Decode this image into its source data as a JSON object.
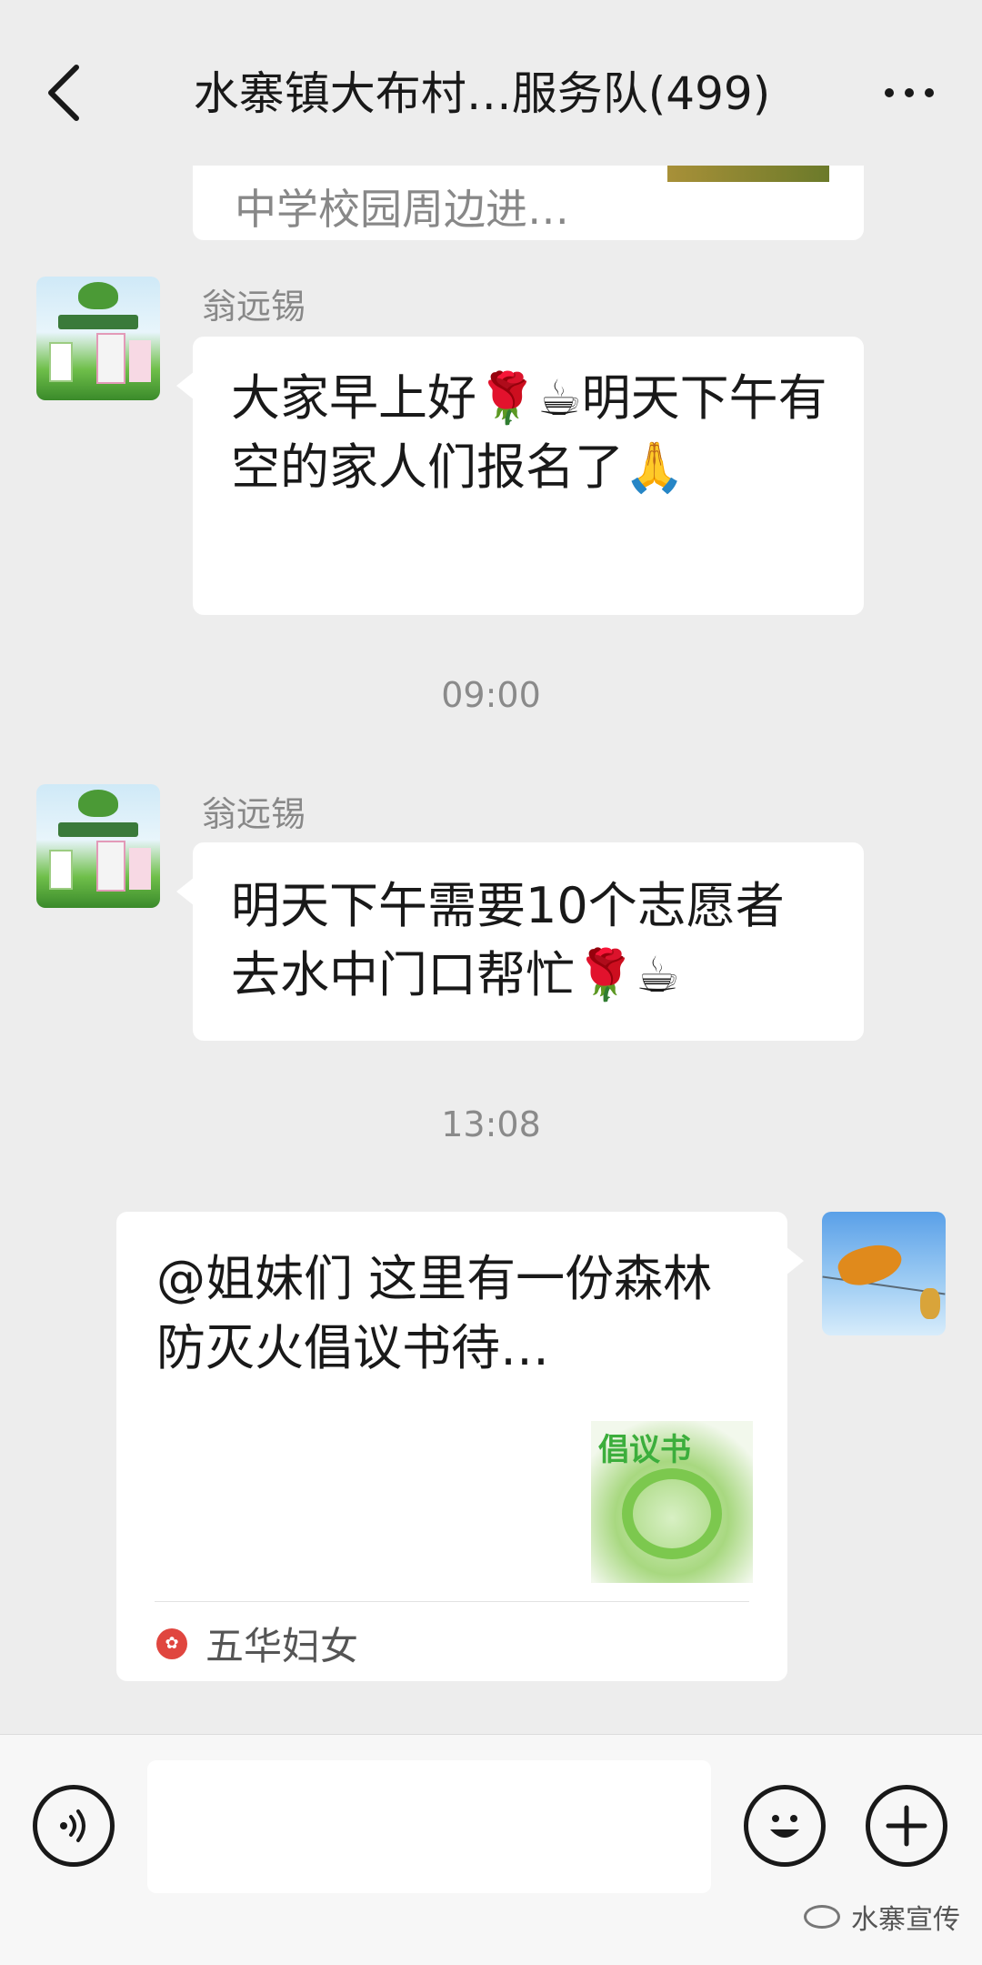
{
  "header": {
    "title": "水寨镇大布村…服务队(499)"
  },
  "messages": [
    {
      "type": "partial_card",
      "text": "中学校园周边进…"
    },
    {
      "type": "text",
      "sender": "翁远锡",
      "text": "大家早上好🌹☕明天下午有空的家人们报名了🙏"
    },
    {
      "type": "time",
      "text": "09:00"
    },
    {
      "type": "text",
      "sender": "翁远锡",
      "text": "明天下午需要10个志愿者去水中门口帮忙🌹☕"
    },
    {
      "type": "time",
      "text": "13:08"
    },
    {
      "type": "link_card",
      "side": "self",
      "text": "@姐妹们  这里有一份森林防灭火倡议书待…",
      "thumb_title": "倡议书",
      "source": "五华妇女"
    }
  ],
  "input": {
    "placeholder": ""
  },
  "watermark": "水寨宣传",
  "icons": {
    "back": "chevron-left-icon",
    "more": "more-dots-icon",
    "voice": "voice-icon",
    "emoji": "emoji-icon",
    "add": "plus-icon"
  },
  "colors": {
    "background": "#ededed",
    "bubble": "#ffffff",
    "text": "#191919",
    "meta": "#888888"
  }
}
